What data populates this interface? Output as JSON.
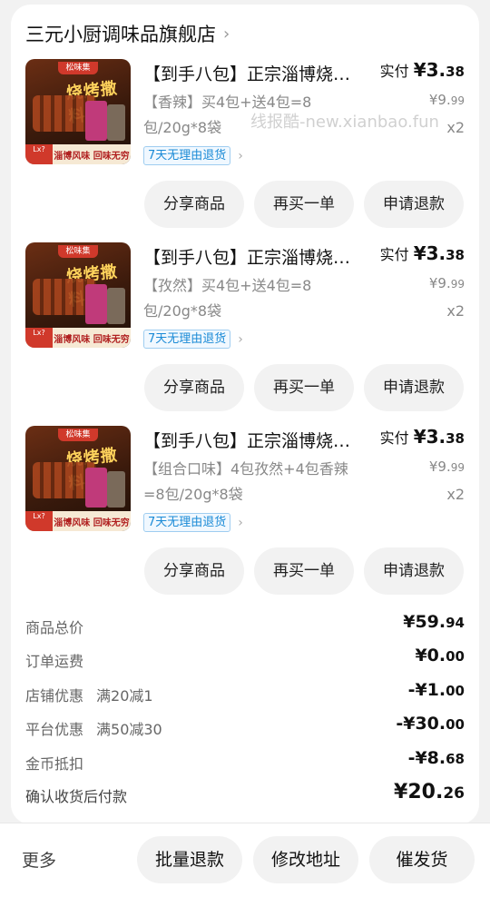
{
  "store": {
    "name": "三元小厨调味品旗舰店",
    "chevron": "›"
  },
  "watermark": "线报酷-new.xianbao.fun",
  "thumbnail": {
    "brand": "松味集",
    "big_text": "烧烤撒料",
    "badge": "Lx?",
    "slogan": "淄博风味 回味无穷"
  },
  "items": [
    {
      "title": "【到手八包】正宗淄博烧烤撒料",
      "spec": "【香辣】买4包+送4包=8包/20g*8袋",
      "paid_label": "实付",
      "paid_int": "¥3.",
      "paid_dec": "38",
      "orig_int": "¥9.",
      "orig_dec": "99",
      "qty": "x2",
      "tag": "7天无理由退货"
    },
    {
      "title": "【到手八包】正宗淄博烧烤撒料",
      "spec": "【孜然】买4包+送4包=8包/20g*8袋",
      "paid_label": "实付",
      "paid_int": "¥3.",
      "paid_dec": "38",
      "orig_int": "¥9.",
      "orig_dec": "99",
      "qty": "x2",
      "tag": "7天无理由退货"
    },
    {
      "title": "【到手八包】正宗淄博烧烤撒料",
      "spec": "【组合口味】4包孜然+4包香辣=8包/20g*8袋",
      "paid_label": "实付",
      "paid_int": "¥3.",
      "paid_dec": "38",
      "orig_int": "¥9.",
      "orig_dec": "99",
      "qty": "x2",
      "tag": "7天无理由退货"
    }
  ],
  "item_buttons": {
    "share": "分享商品",
    "rebuy": "再买一单",
    "refund": "申请退款"
  },
  "summary": [
    {
      "label": "商品总价",
      "sub": "",
      "val_int": "¥59.",
      "val_dec": "94"
    },
    {
      "label": "订单运费",
      "sub": "",
      "val_int": "¥0.",
      "val_dec": "00"
    },
    {
      "label": "店铺优惠",
      "sub": "满20减1",
      "val_int": "-¥1.",
      "val_dec": "00"
    },
    {
      "label": "平台优惠",
      "sub": "满50减30",
      "val_int": "-¥30.",
      "val_dec": "00"
    },
    {
      "label": "金币抵扣",
      "sub": "",
      "val_int": "-¥8.",
      "val_dec": "68"
    },
    {
      "label": "确认收货后付款",
      "sub": "",
      "val_int": "¥20.",
      "val_dec": "26"
    }
  ],
  "bottom_bar": {
    "more": "更多",
    "batch_refund": "批量退款",
    "change_address": "修改地址",
    "urge_ship": "催发货"
  }
}
